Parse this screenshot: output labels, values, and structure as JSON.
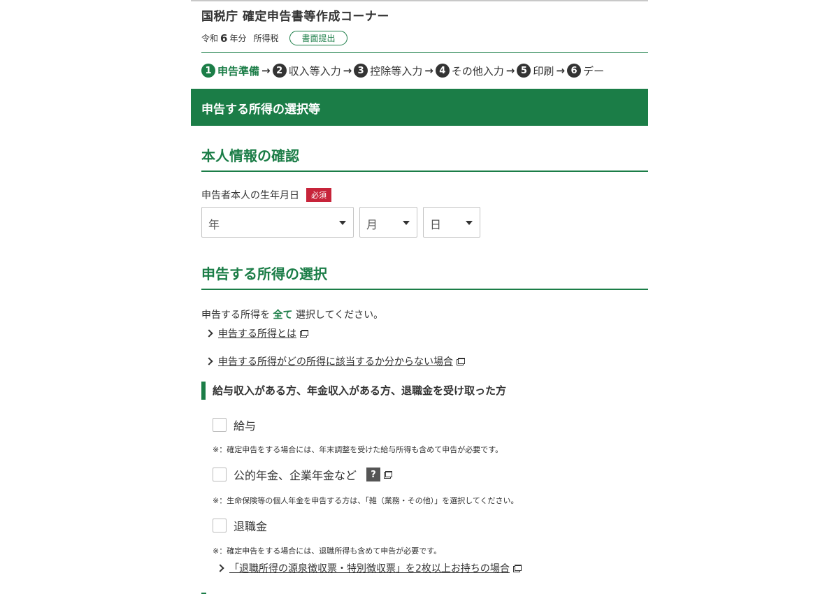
{
  "header": {
    "title": "国税庁 確定申告書等作成コーナー",
    "era": "令和",
    "year": "6",
    "year_suffix": "年分",
    "tax_type": "所得税",
    "submit_button": "書面提出"
  },
  "steps": [
    {
      "num": "1",
      "label": "申告準備",
      "active": true
    },
    {
      "num": "2",
      "label": "収入等入力"
    },
    {
      "num": "3",
      "label": "控除等入力"
    },
    {
      "num": "4",
      "label": "その他入力"
    },
    {
      "num": "5",
      "label": "印刷"
    },
    {
      "num": "6",
      "label": "デー"
    }
  ],
  "page_heading": "申告する所得の選択等",
  "identity": {
    "title": "本人情報の確認",
    "birth_label": "申告者本人の生年月日",
    "required_badge": "必須",
    "year_placeholder": "年",
    "month_placeholder": "月",
    "day_placeholder": "日"
  },
  "income": {
    "title": "申告する所得の選択",
    "intro_pre": "申告する所得を",
    "intro_em": "全て",
    "intro_post": "選択してください。",
    "link1": "申告する所得とは",
    "link2": "申告する所得がどの所得に該当するか分からない場合",
    "group_heading": "給与収入がある方、年金収入がある方、退職金を受け取った方",
    "option_salary": "給与",
    "note_salary": "※：確定申告をする場合には、年末調整を受けた給与所得も含めて申告が必要です。",
    "option_pension": "公的年金、企業年金など",
    "help_label": "?",
    "note_pension": "※：生命保険等の個人年金を申告する方は、「雑（業務・その他）」を選択してください。",
    "option_retirement": "退職金",
    "note_retirement": "※：確定申告をする場合には、退職所得も含めて申告が必要です。",
    "link3": "「退職所得の源泉徴収票・特別徴収票」を2枚以上お持ちの場合"
  },
  "colors": {
    "accent": "#1b7d47",
    "required": "#c7243a"
  }
}
